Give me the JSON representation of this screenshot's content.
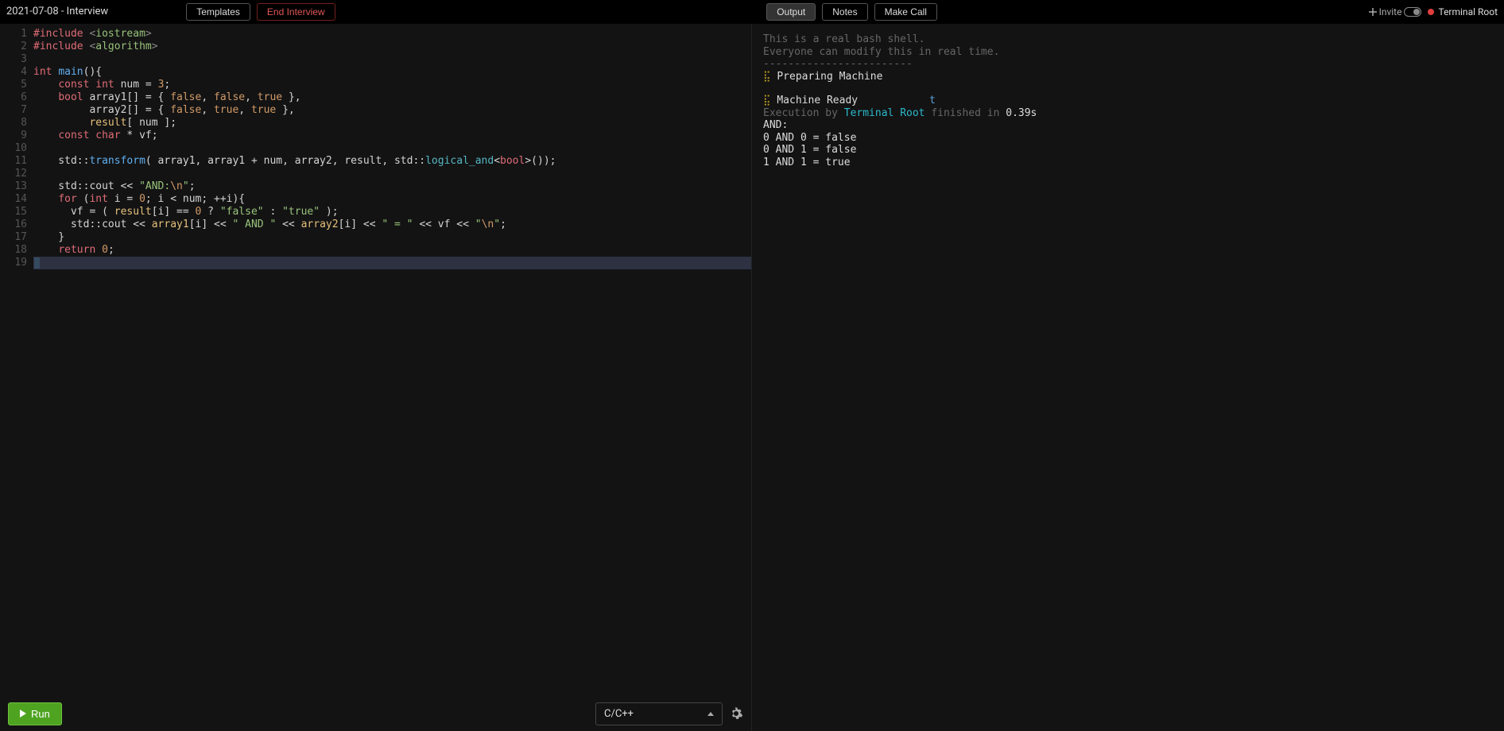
{
  "header": {
    "title": "2021-07-08 - Interview",
    "templates_btn": "Templates",
    "end_btn": "End Interview",
    "output_tab": "Output",
    "notes_tab": "Notes",
    "call_btn": "Make Call",
    "invite_btn": "Invite",
    "user": "Terminal Root"
  },
  "editor": {
    "line_count": 19,
    "active_line": 19,
    "code_lines": [
      [
        [
          "red",
          "#include"
        ],
        [
          "white",
          " "
        ],
        [
          "gray",
          "<"
        ],
        [
          "green",
          "iostream"
        ],
        [
          "gray",
          ">"
        ]
      ],
      [
        [
          "red",
          "#include"
        ],
        [
          "white",
          " "
        ],
        [
          "gray",
          "<"
        ],
        [
          "green",
          "algorithm"
        ],
        [
          "gray",
          ">"
        ]
      ],
      [],
      [
        [
          "red",
          "int"
        ],
        [
          "white",
          " "
        ],
        [
          "blue",
          "main"
        ],
        [
          "white",
          "()"
        ],
        [
          "white",
          "{"
        ]
      ],
      [
        [
          "white",
          "    "
        ],
        [
          "red",
          "const"
        ],
        [
          "white",
          " "
        ],
        [
          "red",
          "int"
        ],
        [
          "white",
          " num = "
        ],
        [
          "orange",
          "3"
        ],
        [
          "white",
          ";"
        ]
      ],
      [
        [
          "white",
          "    "
        ],
        [
          "red",
          "bool"
        ],
        [
          "white",
          " array1[] = { "
        ],
        [
          "orange",
          "false"
        ],
        [
          "white",
          ", "
        ],
        [
          "orange",
          "false"
        ],
        [
          "white",
          ", "
        ],
        [
          "orange",
          "true"
        ],
        [
          "white",
          " },"
        ]
      ],
      [
        [
          "white",
          "         array2[] = { "
        ],
        [
          "orange",
          "false"
        ],
        [
          "white",
          ", "
        ],
        [
          "orange",
          "true"
        ],
        [
          "white",
          ", "
        ],
        [
          "orange",
          "true"
        ],
        [
          "white",
          " },"
        ]
      ],
      [
        [
          "white",
          "         "
        ],
        [
          "yellow",
          "result"
        ],
        [
          "white",
          "[ num ];"
        ]
      ],
      [
        [
          "white",
          "    "
        ],
        [
          "red",
          "const"
        ],
        [
          "white",
          " "
        ],
        [
          "red",
          "char"
        ],
        [
          "white",
          " * vf;"
        ]
      ],
      [],
      [
        [
          "white",
          "    std::"
        ],
        [
          "blue",
          "transform"
        ],
        [
          "white",
          "( array1, array1 + num, array2, result, std::"
        ],
        [
          "cyan",
          "logical_and"
        ],
        [
          "white",
          "<"
        ],
        [
          "red",
          "bool"
        ],
        [
          "white",
          ">());"
        ]
      ],
      [],
      [
        [
          "white",
          "    std::cout << "
        ],
        [
          "green",
          "\"AND:"
        ],
        [
          "orange",
          "\\n"
        ],
        [
          "green",
          "\""
        ],
        [
          "white",
          ";"
        ]
      ],
      [
        [
          "white",
          "    "
        ],
        [
          "red",
          "for"
        ],
        [
          "white",
          " ("
        ],
        [
          "red",
          "int"
        ],
        [
          "white",
          " i = "
        ],
        [
          "orange",
          "0"
        ],
        [
          "white",
          "; i < num; ++i){"
        ]
      ],
      [
        [
          "white",
          "      vf = ( "
        ],
        [
          "yellow",
          "result"
        ],
        [
          "white",
          "[i] == "
        ],
        [
          "orange",
          "0"
        ],
        [
          "white",
          " ? "
        ],
        [
          "green",
          "\"false\""
        ],
        [
          "white",
          " : "
        ],
        [
          "green",
          "\"true\""
        ],
        [
          "white",
          " );"
        ]
      ],
      [
        [
          "white",
          "      std::cout << "
        ],
        [
          "yellow",
          "array1"
        ],
        [
          "white",
          "[i] << "
        ],
        [
          "green",
          "\" AND \""
        ],
        [
          "white",
          " << "
        ],
        [
          "yellow",
          "array2"
        ],
        [
          "white",
          "[i] << "
        ],
        [
          "green",
          "\" = \""
        ],
        [
          "white",
          " << vf << "
        ],
        [
          "green",
          "\""
        ],
        [
          "orange",
          "\\n"
        ],
        [
          "green",
          "\""
        ],
        [
          "white",
          ";"
        ]
      ],
      [
        [
          "white",
          "    }"
        ]
      ],
      [
        [
          "white",
          "    "
        ],
        [
          "red",
          "return"
        ],
        [
          "white",
          " "
        ],
        [
          "orange",
          "0"
        ],
        [
          "white",
          ";"
        ]
      ],
      [
        [
          "white",
          "}"
        ]
      ]
    ]
  },
  "footer": {
    "run": "Run",
    "language": "C/C++"
  },
  "output": {
    "intro1": "This is a real bash shell.",
    "intro2": "Everyone can modify this in real time.",
    "divider": "------------------------",
    "preparing": "Preparing Machine",
    "ready": "Machine Ready",
    "ready_mark": "t",
    "exec_pre": "Execution by ",
    "exec_user": "Terminal Root",
    "exec_mid": " finished in ",
    "exec_time": "0.39s",
    "lines": [
      "AND:",
      "0 AND 0 = false",
      "0 AND 1 = false",
      "1 AND 1 = true"
    ]
  }
}
